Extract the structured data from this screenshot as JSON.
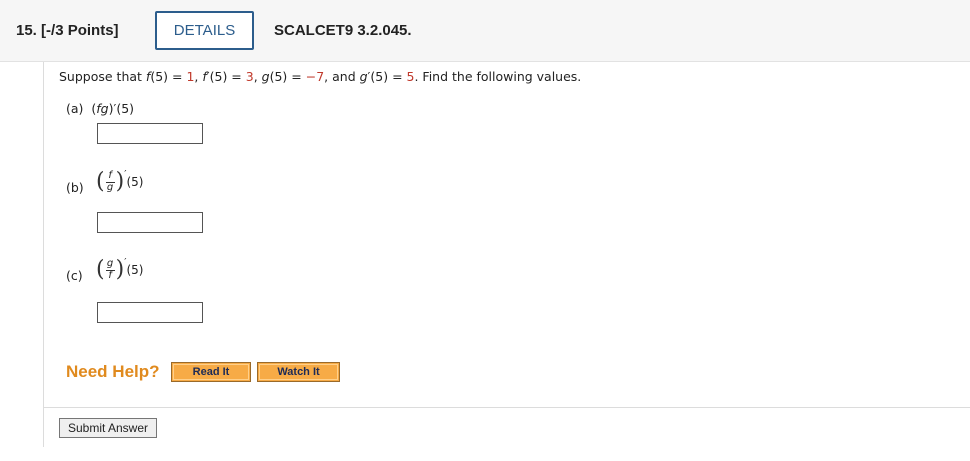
{
  "header": {
    "question_number": "15.",
    "points": "[-/3 Points]",
    "details_label": "DETAILS",
    "problem_code": "SCALCET9 3.2.045."
  },
  "prompt": {
    "intro": "Suppose that ",
    "f5_label": "f",
    "f5_arg": "(5) = ",
    "f5_value": "1",
    "sep1": ", ",
    "fp5_label": "f",
    "fp5_arg": "′(5) = ",
    "fp5_value": "3",
    "sep2": ", ",
    "g5_label": "g",
    "g5_arg": "(5) = ",
    "g5_value": "−7",
    "sep3": ", and ",
    "gp5_label": "g",
    "gp5_arg": "′(5) = ",
    "gp5_value": "5",
    "outro": ". Find the following values."
  },
  "parts": {
    "a": {
      "label": "(a)",
      "expr_open": "(",
      "expr_fg": "fg",
      "expr_close": ")′(5)",
      "answer": ""
    },
    "b": {
      "label": "(b)",
      "num": "f",
      "den": "g",
      "prime": "′",
      "arg": "(5)",
      "answer": ""
    },
    "c": {
      "label": "(c)",
      "num": "g",
      "den": "f",
      "prime": "′",
      "arg": "(5)",
      "answer": ""
    }
  },
  "help": {
    "label": "Need Help?",
    "read_it": "Read It",
    "watch_it": "Watch It"
  },
  "submit": {
    "label": "Submit Answer"
  },
  "colors": {
    "accent": "#2c5d8c",
    "help_orange": "#e08a1e",
    "button_orange": "#f7ab46",
    "given_red": "#c0392b"
  }
}
